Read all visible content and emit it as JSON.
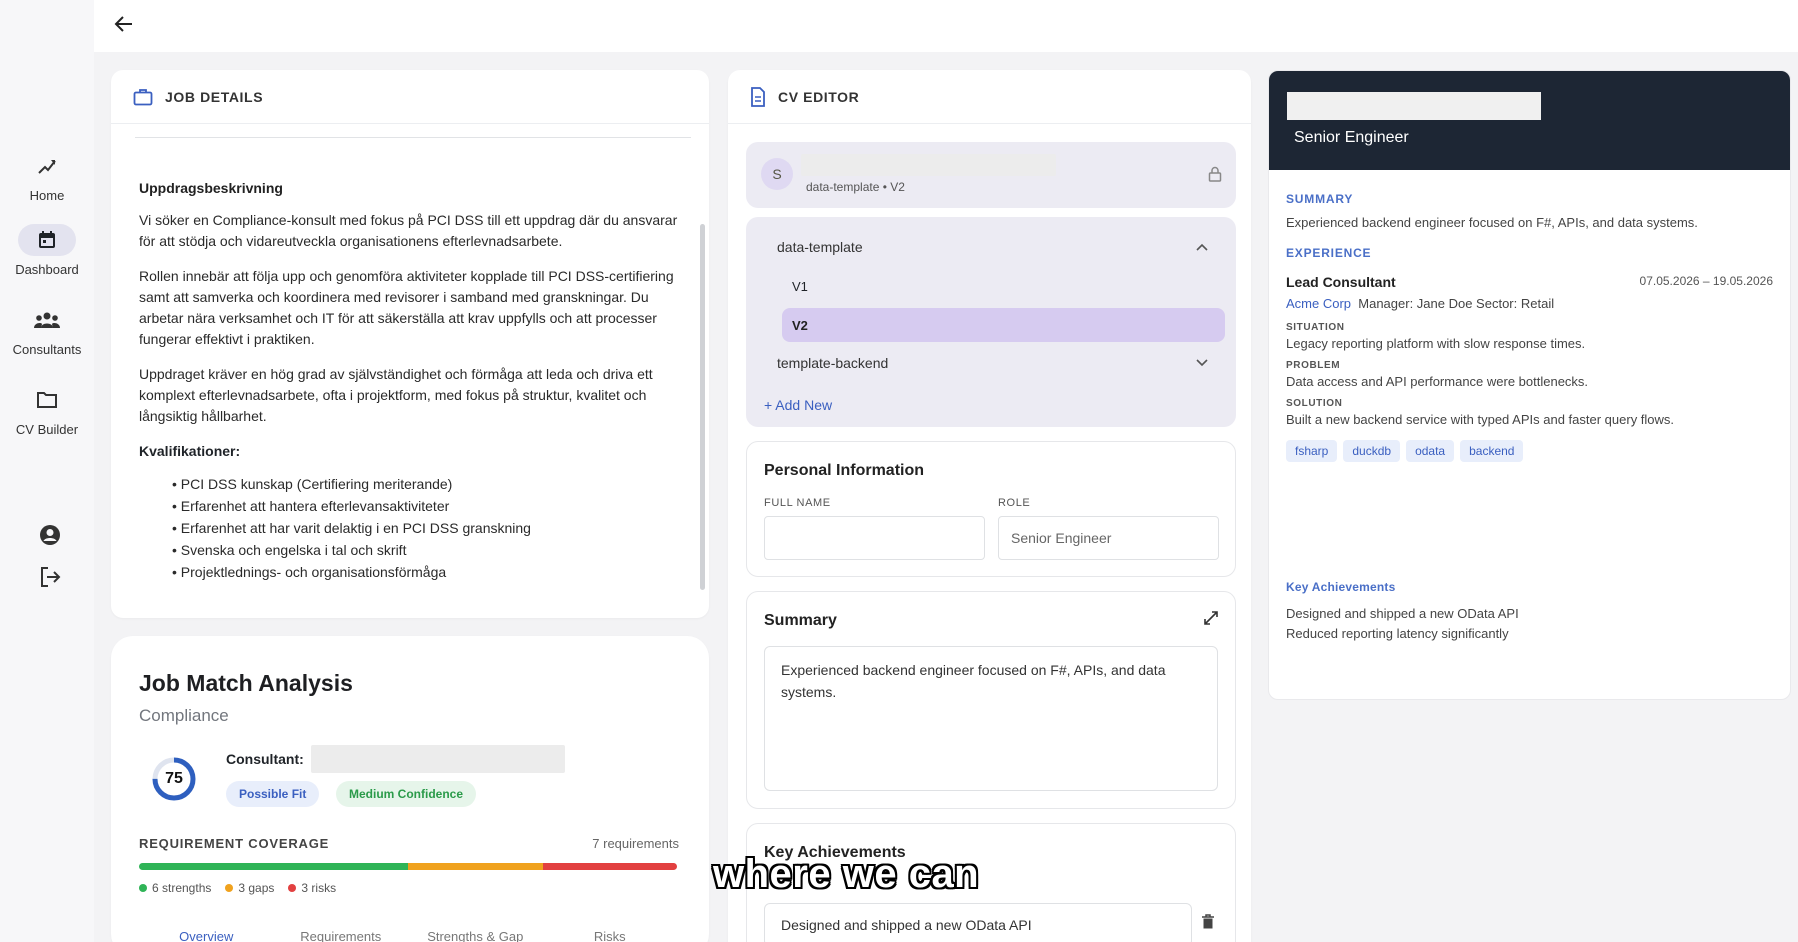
{
  "sidebar": {
    "items": [
      {
        "label": "Home",
        "icon": "home-icon"
      },
      {
        "label": "Dashboard",
        "icon": "calendar-icon"
      },
      {
        "label": "Consultants",
        "icon": "people-icon"
      },
      {
        "label": "CV Builder",
        "icon": "folder-icon"
      }
    ],
    "active": "Dashboard"
  },
  "job_details": {
    "title": "JOB DETAILS",
    "heading": "Uppdragsbeskrivning",
    "paragraphs": [
      "Vi söker en Compliance-konsult med fokus på PCI DSS till ett uppdrag där du ansvarar för att stödja och vidareutveckla organisationens efterlevnadsarbete.",
      "Rollen innebär att följa upp och genomföra aktiviteter kopplade till PCI DSS-certifiering samt att samverka och koordinera med revisorer i samband med granskningar. Du arbetar nära verksamhet och IT för att säkerställa att krav uppfylls och att processer fungerar effektivt i praktiken.",
      "Uppdraget kräver en hög grad av självständighet och förmåga att leda och driva ett komplext efterlevnadsarbete, ofta i projektform, med fokus på struktur, kvalitet och långsiktig hållbarhet."
    ],
    "qualifications_heading": "Kvalifikationer:",
    "qualifications": [
      "• PCI DSS kunskap (Certifiering meriterande)",
      "• Erfarenhet att hantera efterlevansaktiviteter",
      "• Erfarenhet att har varit delaktig i en PCI DSS granskning",
      "• Svenska och engelska i tal och skrift",
      "• Projektlednings- och organisationsförmåga"
    ]
  },
  "job_match": {
    "title": "Job Match Analysis",
    "subtitle": "Compliance",
    "score": "75",
    "score_fraction": 0.75,
    "consultant_label": "Consultant:",
    "badges": [
      "Possible Fit",
      "Medium Confidence"
    ],
    "requirement_coverage_label": "REQUIREMENT COVERAGE",
    "requirements_count": "7 requirements",
    "coverage": {
      "strengths": 6,
      "gaps": 3,
      "risks": 3
    },
    "legend": [
      "6 strengths",
      "3 gaps",
      "3 risks"
    ],
    "tabs": [
      "Overview",
      "Requirements",
      "Strengths & Gap",
      "Risks"
    ],
    "active_tab": "Overview",
    "colors": {
      "strength": "#2fb457",
      "gap": "#f0a21e",
      "risk": "#e24040",
      "ring": "#2e5fbf"
    }
  },
  "cv_editor": {
    "title": "CV EDITOR",
    "avatar_initial": "S",
    "version_subtitle": "data-template • V2",
    "templates": [
      {
        "name": "data-template",
        "expanded": true,
        "versions": [
          "V1",
          "V2"
        ],
        "selected": "V2"
      },
      {
        "name": "template-backend",
        "expanded": false
      }
    ],
    "add_new": "+ Add New",
    "personal_info": {
      "title": "Personal Information",
      "full_name_label": "FULL NAME",
      "full_name_value": "",
      "role_label": "ROLE",
      "role_value": "Senior Engineer"
    },
    "summary": {
      "title": "Summary",
      "text": "Experienced backend engineer focused on F#, APIs, and data systems."
    },
    "key_achievements": {
      "title": "Key Achievements",
      "items": [
        "Designed and shipped a new OData API"
      ]
    }
  },
  "preview": {
    "role": "Senior Engineer",
    "summary_label": "SUMMARY",
    "summary": "Experienced backend engineer focused on F#, APIs, and data systems.",
    "experience_label": "EXPERIENCE",
    "job_title": "Lead Consultant",
    "dates": "07.05.2026 – 19.05.2026",
    "company": "Acme Corp",
    "meta": "Manager: Jane Doe   Sector: Retail",
    "situation_label": "SITUATION",
    "situation": "Legacy reporting platform with slow response times.",
    "problem_label": "PROBLEM",
    "problem": "Data access and API performance were bottlenecks.",
    "solution_label": "SOLUTION",
    "solution": "Built a new backend service with typed APIs and faster query flows.",
    "tags": [
      "fsharp",
      "duckdb",
      "odata",
      "backend"
    ],
    "achievements_label": "Key Achievements",
    "achievements": [
      "Designed and shipped a new OData API",
      "Reduced reporting latency significantly"
    ]
  },
  "caption": "where we can"
}
